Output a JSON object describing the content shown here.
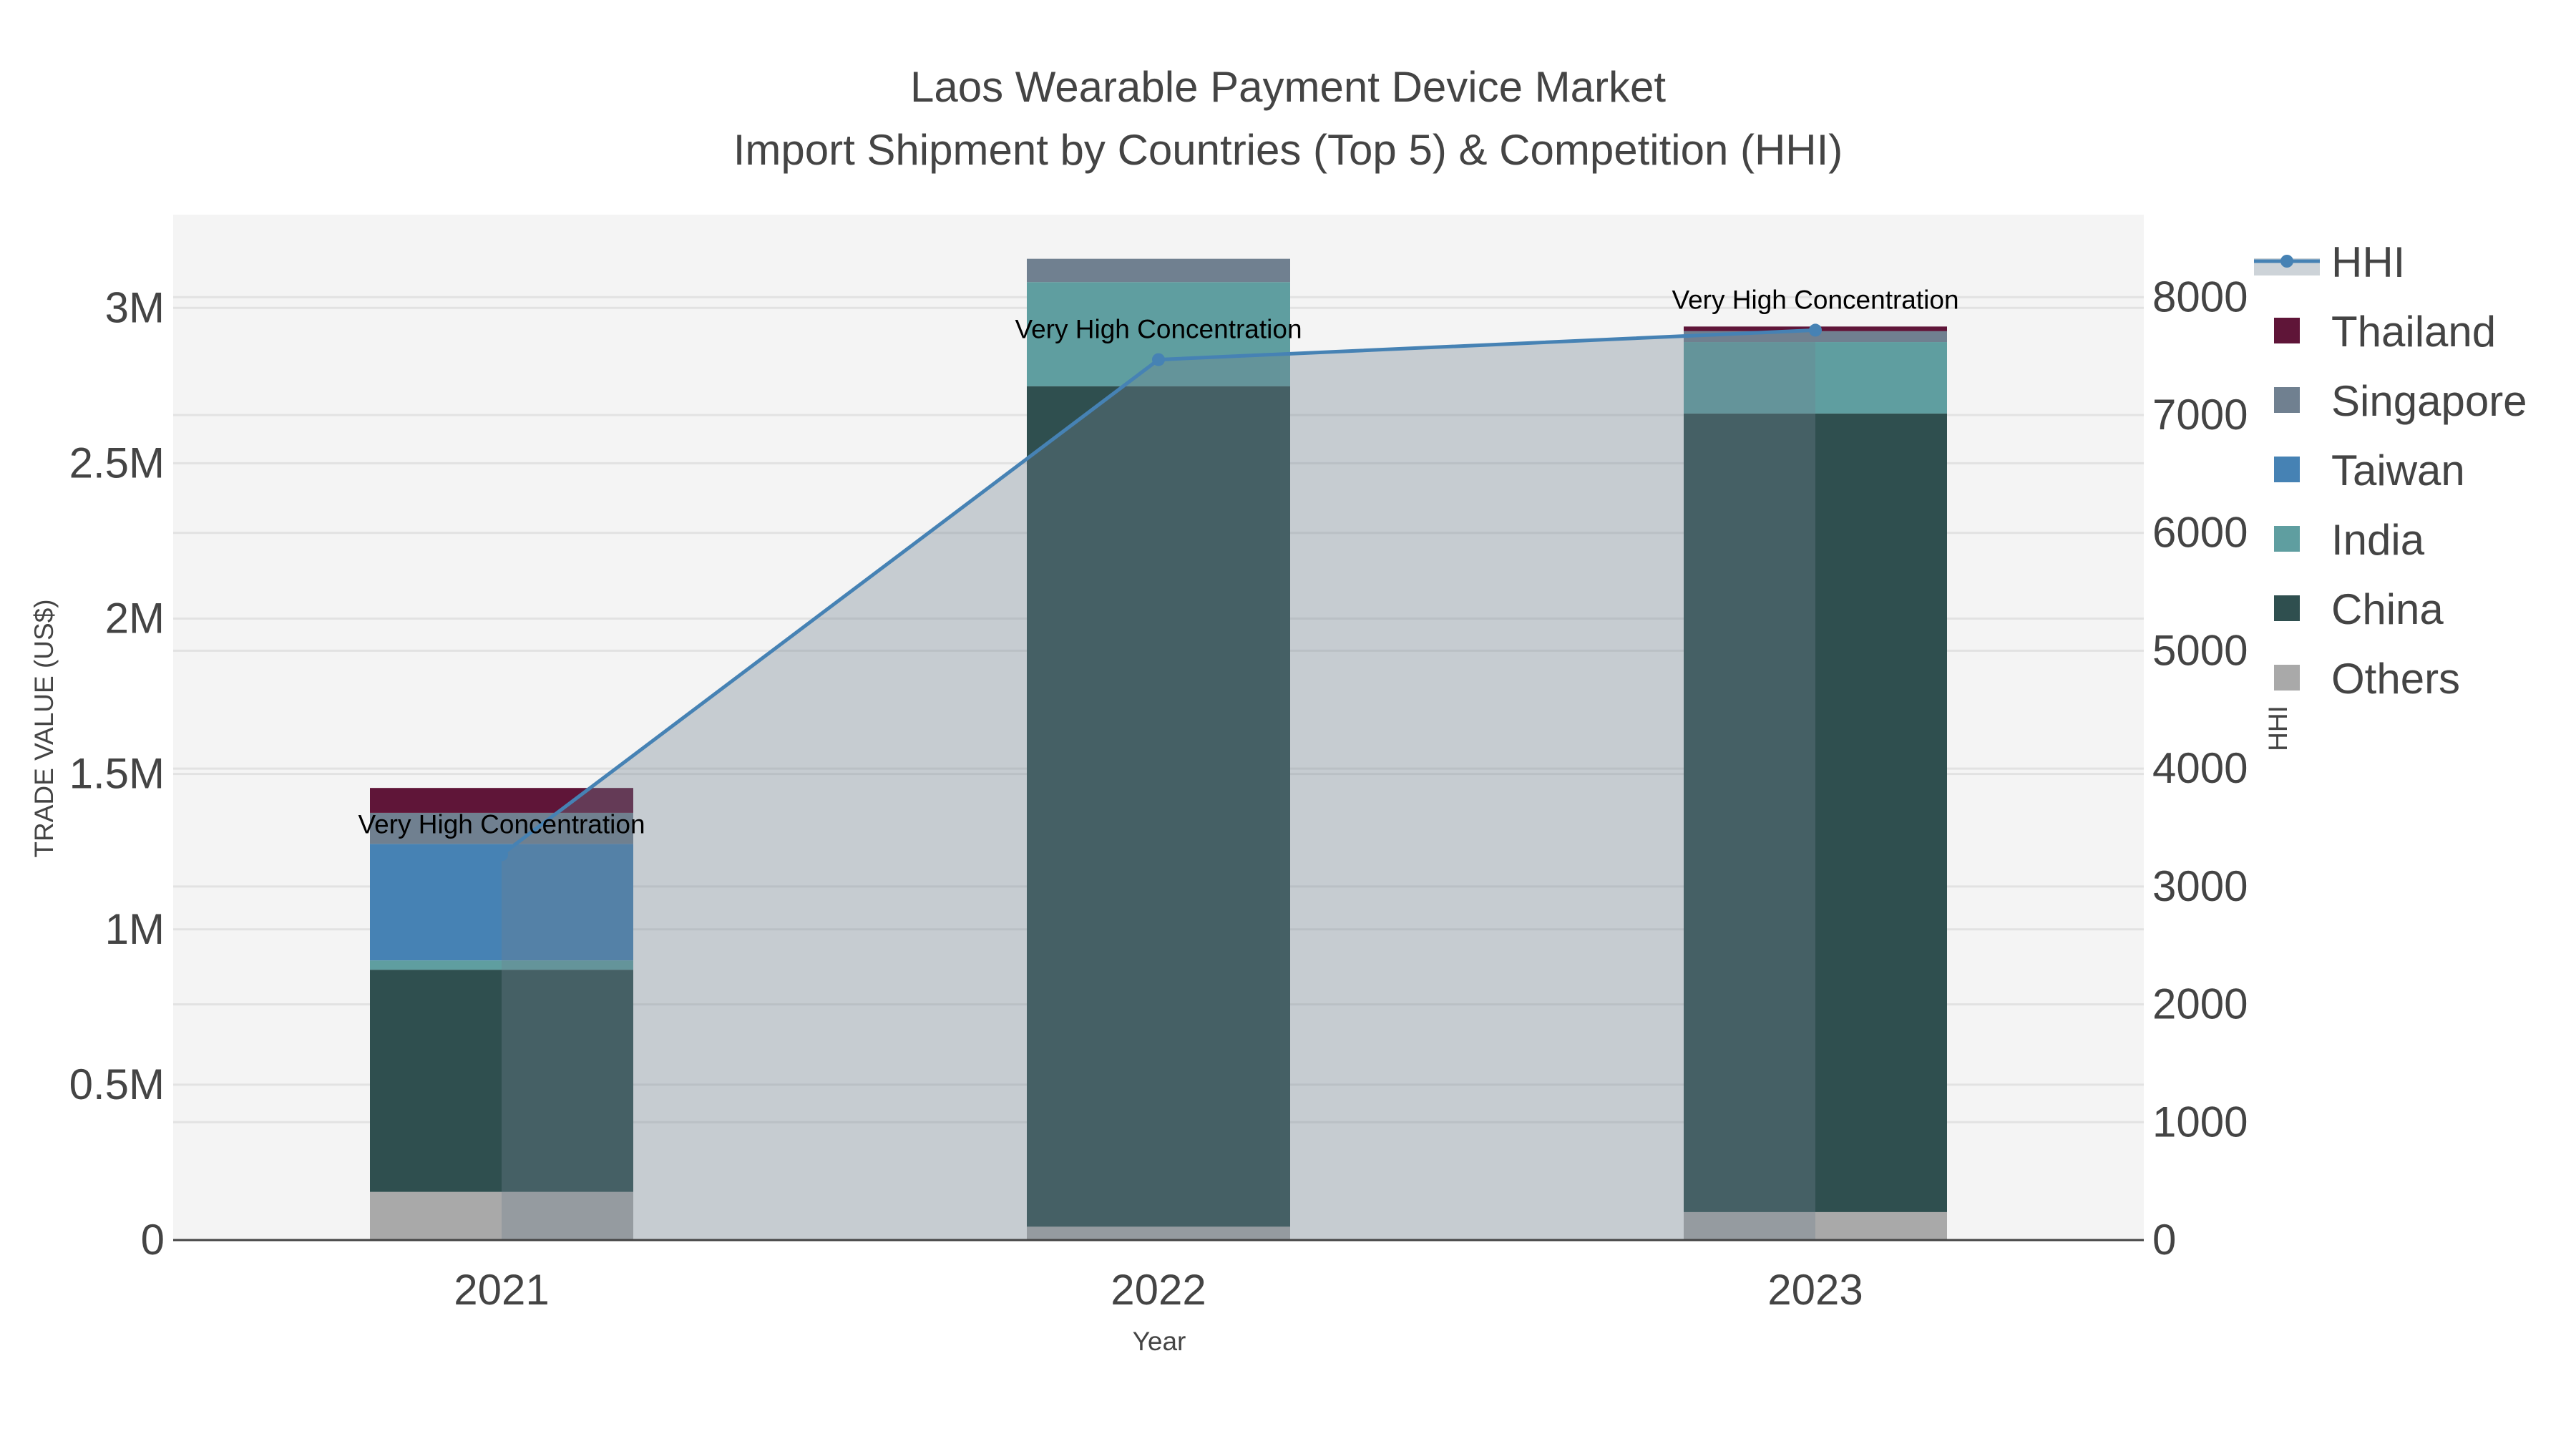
{
  "chart_data": {
    "type": "bar",
    "title": "Laos Wearable Payment Device Market",
    "subtitle": "Import Shipment by Countries (Top 5) & Competition (HHI)",
    "xlabel": "Year",
    "ylabel": "TRADE VALUE (US$)",
    "y2label": "HHI",
    "categories": [
      "2021",
      "2022",
      "2023"
    ],
    "ylim": [
      0,
      3300000
    ],
    "y2lim": [
      0,
      8700
    ],
    "yticks": [
      0,
      500000,
      1000000,
      1500000,
      2000000,
      2500000,
      3000000
    ],
    "ytick_labels": [
      "0",
      "0.5M",
      "1M",
      "1.5M",
      "2M",
      "2.5M",
      "3M"
    ],
    "y2ticks": [
      0,
      1000,
      2000,
      3000,
      4000,
      5000,
      6000,
      7000,
      8000
    ],
    "y2tick_labels": [
      "0",
      "1000",
      "2000",
      "3000",
      "4000",
      "5000",
      "6000",
      "7000",
      "8000"
    ],
    "stacking": "stacked",
    "series": [
      {
        "name": "Others",
        "color": "#a9a9a9",
        "values": [
          155000,
          43000,
          90000
        ]
      },
      {
        "name": "China",
        "color": "#2f4f4f",
        "values": [
          715000,
          2705000,
          2570000
        ]
      },
      {
        "name": "India",
        "color": "#5f9ea0",
        "values": [
          30000,
          335000,
          230000
        ]
      },
      {
        "name": "Taiwan",
        "color": "#4682b4",
        "values": [
          375000,
          0,
          0
        ]
      },
      {
        "name": "Singapore",
        "color": "#708090",
        "values": [
          100000,
          75000,
          35000
        ]
      },
      {
        "name": "Thailand",
        "color": "#5f1538",
        "values": [
          80000,
          0,
          15000
        ]
      }
    ],
    "line": {
      "name": "HHI",
      "axis": "right",
      "color": "#4682b4",
      "fill": "tozeroy",
      "values": [
        3270,
        7470,
        7720
      ]
    },
    "annotations": [
      "Very High Concentration",
      "Very High Concentration",
      "Very High Concentration"
    ],
    "legend": {
      "placement": "right",
      "order": [
        "HHI",
        "Thailand",
        "Singapore",
        "Taiwan",
        "India",
        "China",
        "Others"
      ]
    }
  }
}
